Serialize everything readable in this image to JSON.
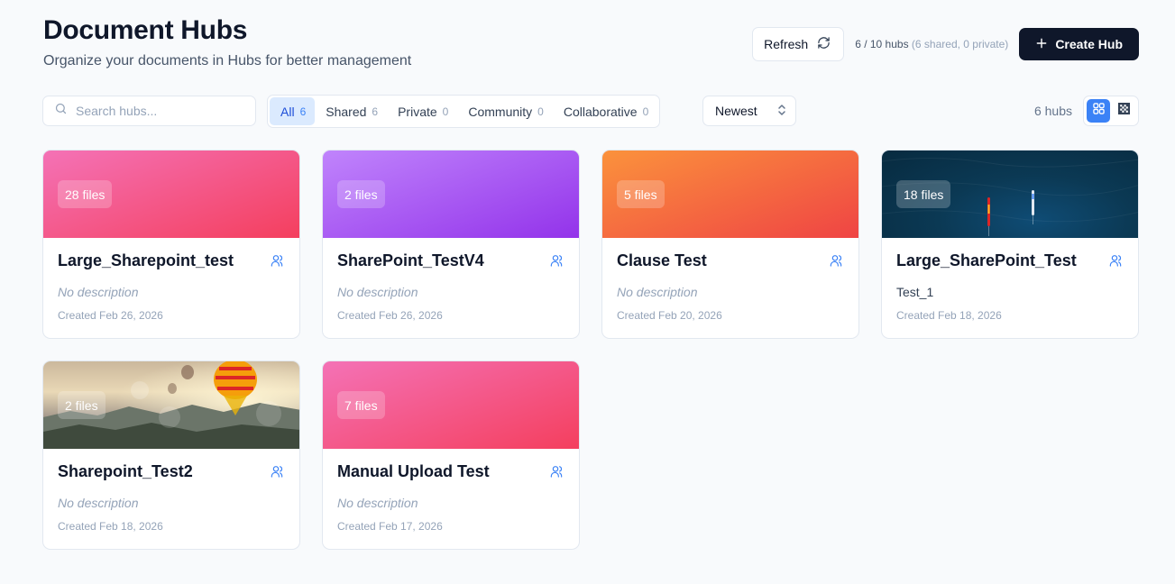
{
  "header": {
    "title": "Document Hubs",
    "subtitle": "Organize your documents in Hubs for better management",
    "refresh_label": "Refresh",
    "hub_usage": "6 / 10 hubs",
    "hub_usage_detail": "(6 shared, 0 private)",
    "create_label": "Create Hub"
  },
  "toolbar": {
    "search_placeholder": "Search hubs...",
    "filters": [
      {
        "label": "All",
        "count": "6",
        "active": true
      },
      {
        "label": "Shared",
        "count": "6"
      },
      {
        "label": "Private",
        "count": "0"
      },
      {
        "label": "Community",
        "count": "0"
      },
      {
        "label": "Collaborative",
        "count": "0"
      }
    ],
    "sort_value": "Newest",
    "result_count": "6 hubs",
    "view_modes": [
      "grid-view-icon",
      "mosaic-view-icon"
    ]
  },
  "hubs": [
    {
      "files": "28 files",
      "name": "Large_Sharepoint_test",
      "description": "No description",
      "created": "Created Feb 26, 2026",
      "banner": "pink-gradient",
      "shared_icon": "users-icon"
    },
    {
      "files": "2 files",
      "name": "SharePoint_TestV4",
      "description": "No description",
      "created": "Created Feb 26, 2026",
      "banner": "purple-gradient",
      "shared_icon": "users-icon"
    },
    {
      "files": "5 files",
      "name": "Clause Test",
      "description": "No description",
      "created": "Created Feb 20, 2026",
      "banner": "orange-gradient",
      "shared_icon": "users-icon"
    },
    {
      "files": "18 files",
      "name": "Large_SharePoint_Test",
      "description": "Test_1",
      "created": "Created Feb 18, 2026",
      "banner": "ocean-photo",
      "shared_icon": "users-icon"
    },
    {
      "files": "2 files",
      "name": "Sharepoint_Test2",
      "description": "No description",
      "created": "Created Feb 18, 2026",
      "banner": "balloon-photo",
      "shared_icon": "users-icon"
    },
    {
      "files": "7 files",
      "name": "Manual Upload Test",
      "description": "No description",
      "created": "Created Feb 17, 2026",
      "banner": "pink-gradient",
      "shared_icon": "users-icon"
    }
  ],
  "colors": {
    "primary": "#0f172a",
    "accent": "#3b82f6",
    "active_tab_bg": "#dbeafe"
  }
}
